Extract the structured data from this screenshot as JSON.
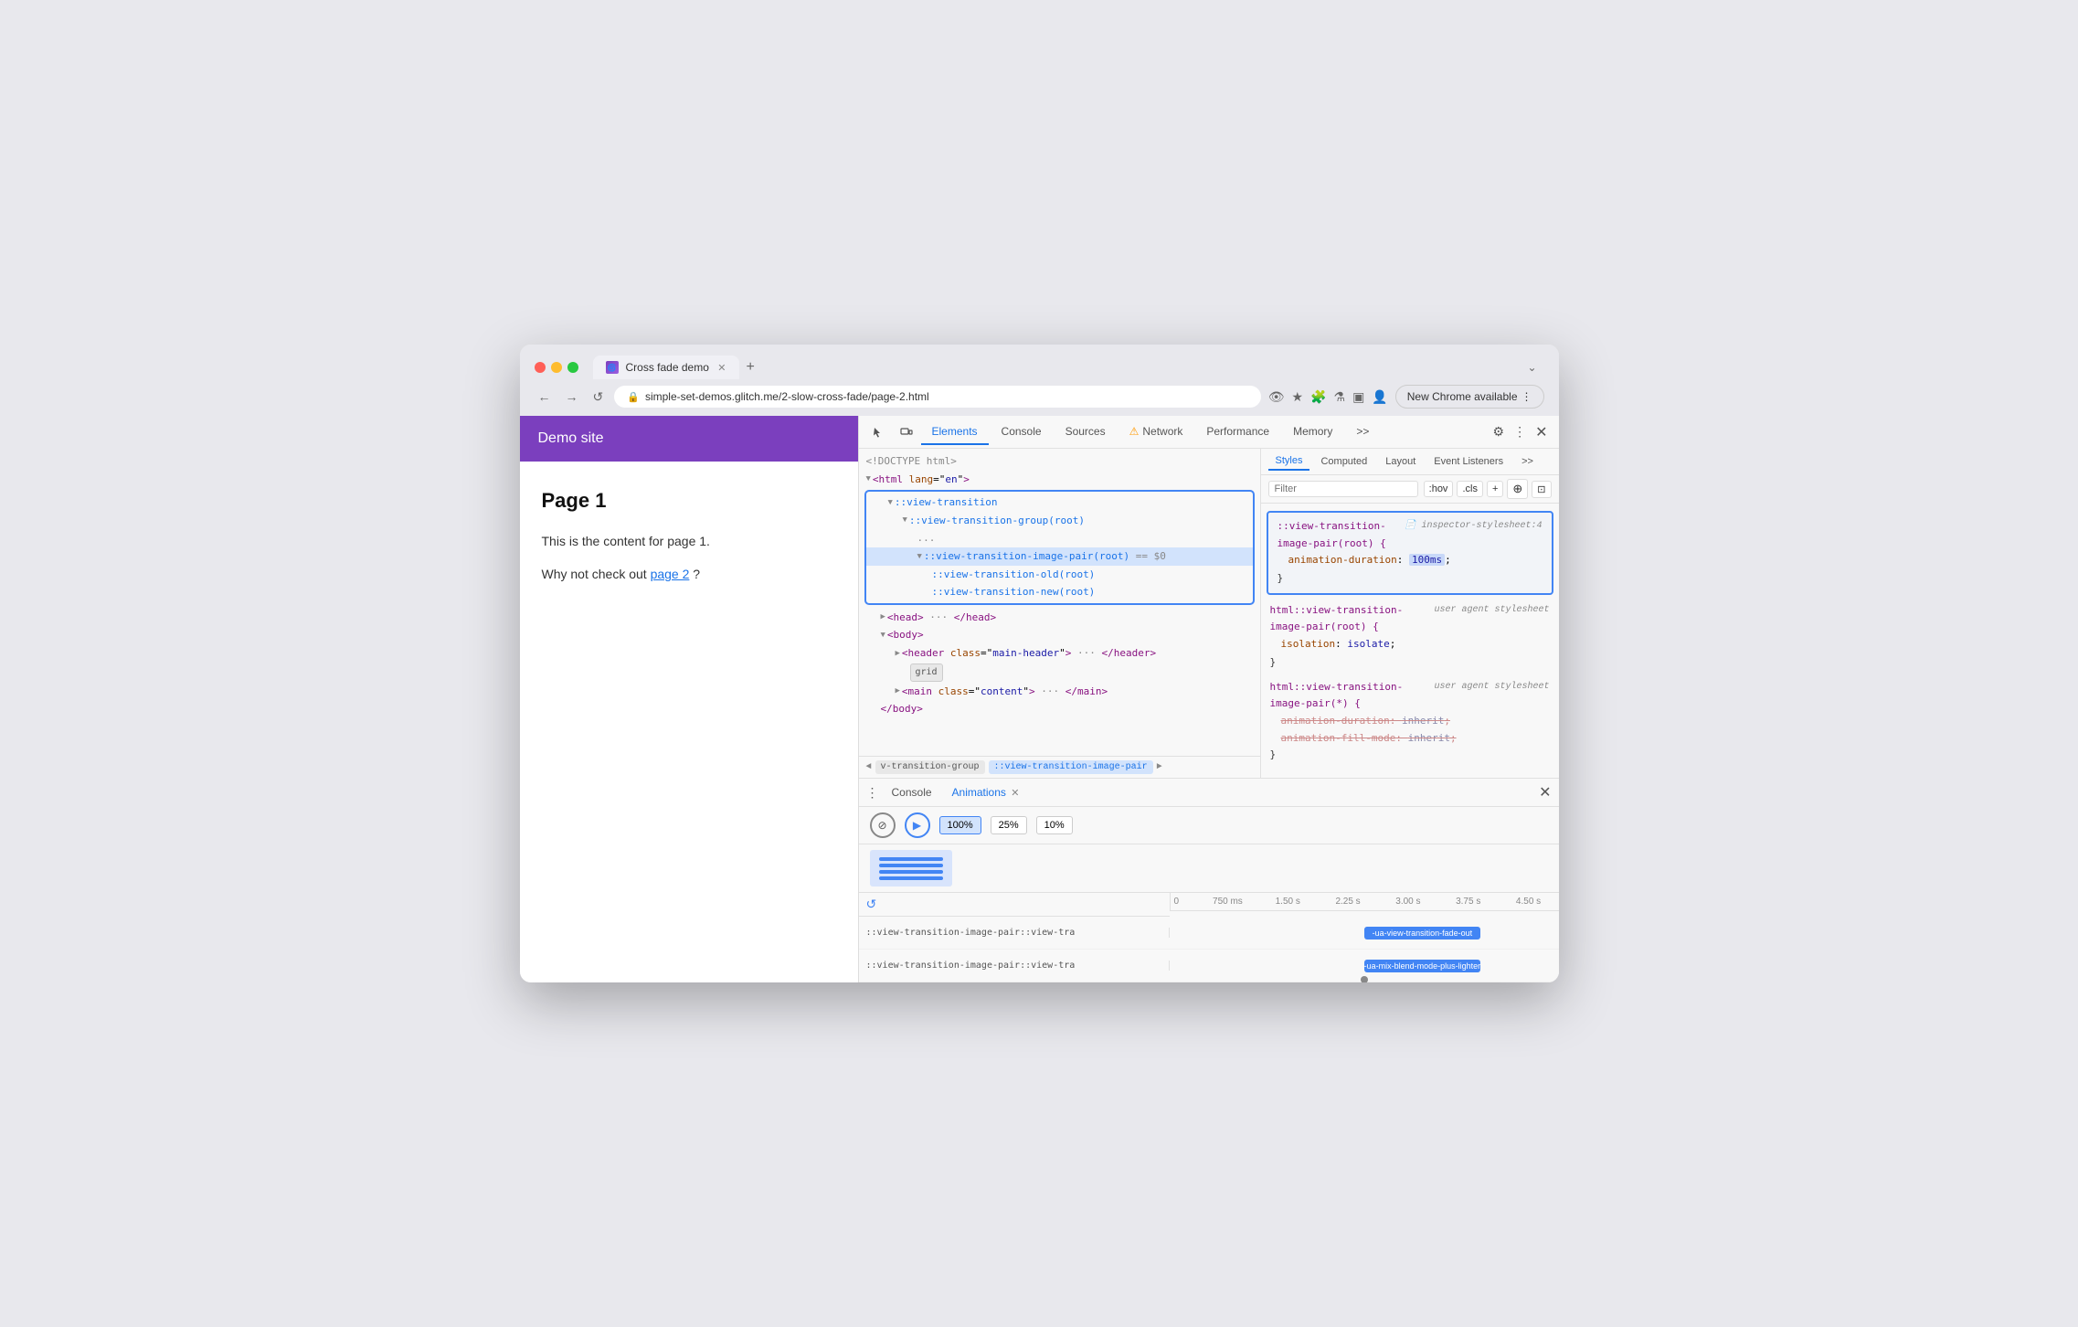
{
  "browser": {
    "tab_title": "Cross fade demo",
    "tab_favicon": "🌀",
    "new_tab_btn": "+",
    "expand_btn": "⌄",
    "address": "simple-set-demos.glitch.me/2-slow-cross-fade/page-2.html",
    "new_chrome_label": "New Chrome available",
    "nav": {
      "back": "←",
      "forward": "→",
      "refresh": "↺"
    }
  },
  "demo_site": {
    "header": "Demo site",
    "page_title": "Page 1",
    "text1": "This is the content for page 1.",
    "text2": "Why not check out",
    "link": "page 2",
    "text3": "?"
  },
  "devtools": {
    "tabs": [
      "Elements",
      "Console",
      "Sources",
      "Network",
      "Performance",
      "Memory",
      ">>"
    ],
    "active_tab": "Elements",
    "network_warning": "⚠",
    "right_tabs": [
      "Styles",
      "Computed",
      "Layout",
      "Event Listeners",
      ">>"
    ],
    "active_right_tab": "Styles",
    "filter_placeholder": "Filter",
    "filter_hov": ":hov",
    "filter_cls": ".cls",
    "elements_content": [
      {
        "text": "<!DOCTYPE html>",
        "indent": 0,
        "type": "doctype"
      },
      {
        "text": "<html lang=\"en\">",
        "indent": 0,
        "type": "tag"
      },
      {
        "text": "::view-transition",
        "indent": 1,
        "type": "pseudo",
        "blue_box_start": true
      },
      {
        "text": "::view-transition-group(root)",
        "indent": 2,
        "type": "pseudo"
      },
      {
        "text": "...",
        "indent": 2,
        "type": "dots"
      },
      {
        "text": "::view-transition-image-pair(root) == $0",
        "indent": 3,
        "type": "pseudo"
      },
      {
        "text": "::view-transition-old(root)",
        "indent": 4,
        "type": "pseudo"
      },
      {
        "text": "::view-transition-new(root)",
        "indent": 4,
        "type": "pseudo",
        "blue_box_end": true
      },
      {
        "text": "<head> ··· </head>",
        "indent": 1,
        "type": "tag"
      },
      {
        "text": "<body>",
        "indent": 1,
        "type": "tag"
      },
      {
        "text": "<header class=\"main-header\"> ··· </header>",
        "indent": 2,
        "type": "tag"
      },
      {
        "text": "grid",
        "indent": 3,
        "type": "badge"
      },
      {
        "text": "<main class=\"content\"> ··· </main>",
        "indent": 2,
        "type": "tag"
      },
      {
        "text": "</body>",
        "indent": 1,
        "type": "tag"
      }
    ],
    "breadcrumb": [
      {
        "text": "◄",
        "type": "arrow"
      },
      {
        "text": "v-transition-group",
        "selected": false
      },
      {
        "text": "::view-transition-image-pair",
        "selected": true
      },
      {
        "text": "►",
        "type": "arrow"
      }
    ],
    "styles": [
      {
        "selector": "::view-transition-image-pair(root) {",
        "source": "inspector-stylesheet:4",
        "props": [
          {
            "name": "animation-duration",
            "value": "100ms",
            "highlighted": true
          }
        ],
        "close": "}",
        "highlighted": true
      },
      {
        "selector": "html::view-transition-image-pair(root) {",
        "source": "user agent stylesheet",
        "props": [
          {
            "name": "isolation",
            "value": "isolate",
            "strikethrough": false
          }
        ],
        "close": "}",
        "highlighted": false
      },
      {
        "selector": "html::view-transition-image-pair(*) {",
        "source": "user agent stylesheet",
        "props": [
          {
            "name": "animation-duration",
            "value": "inherit",
            "strikethrough": true
          },
          {
            "name": "animation-fill-mode",
            "value": "inherit",
            "strikethrough": true
          }
        ],
        "close": "}",
        "highlighted": false
      }
    ],
    "drawer": {
      "tabs": [
        "Console",
        "Animations"
      ],
      "active_tab": "Animations",
      "controls": {
        "cancel_label": "⊘",
        "play_label": "▶",
        "speeds": [
          "100%",
          "25%",
          "10%"
        ]
      },
      "timeline": {
        "marks": [
          "0",
          "750 ms",
          "1.50 s",
          "2.25 s",
          "3.00 s",
          "3.75 s",
          "4.50 s"
        ],
        "rows": [
          {
            "label": "::view-transition-image-pair::view-tra",
            "bar_text": "-ua-view-transition-fade-out",
            "bar_left": "50%",
            "bar_width": "30%"
          },
          {
            "label": "::view-transition-image-pair::view-tra",
            "bar_text": "-ua-mix-blend-mode-plus-lighter",
            "bar_left": "50%",
            "bar_width": "30%"
          }
        ]
      }
    }
  }
}
